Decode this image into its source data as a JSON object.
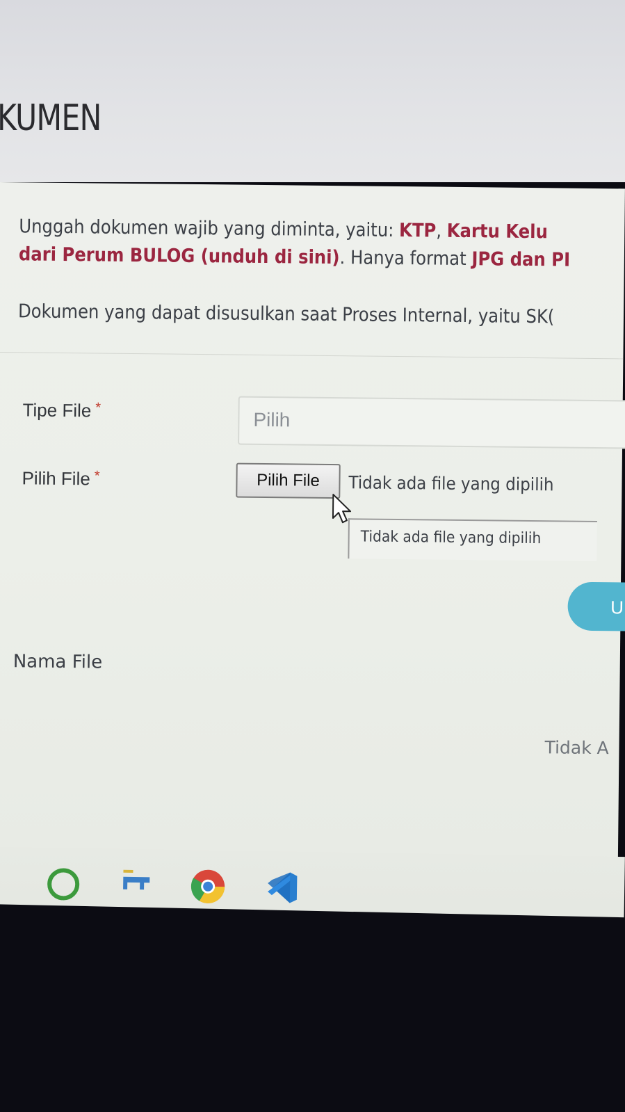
{
  "header": {
    "title": "KUMEN"
  },
  "instructions": {
    "line1_prefix": "Unggah dokumen wajib yang diminta, yaitu: ",
    "line1_bold_1": "KTP",
    "line1_sep": ", ",
    "line1_bold_2": "Kartu Kelu",
    "line2_bold": "dari Perum BULOG (unduh di sini)",
    "line2_text": ". Hanya format ",
    "line2_bold_2": "JPG dan PI",
    "line3": "Dokumen yang dapat disusulkan saat Proses Internal, yaitu SK("
  },
  "form": {
    "tipe_file_label": "Tipe File",
    "pilih_file_label": "Pilih File",
    "required_mark": "*",
    "tipe_file_placeholder": "Pilih",
    "file_button_label": "Pilih File",
    "file_status": "Tidak ada file yang dipilih",
    "tooltip_text": "Tidak ada file yang dipilih",
    "upload_button_label": "U"
  },
  "table": {
    "column_nama_file": "Nama File",
    "empty_text": "Tidak A"
  },
  "taskbar": {
    "icons": [
      "cortana-ring-icon",
      "file-explorer-icon",
      "chrome-icon",
      "vscode-icon"
    ]
  },
  "colors": {
    "accent_bold": "#9b2640",
    "upload_button": "#52b5cf"
  }
}
